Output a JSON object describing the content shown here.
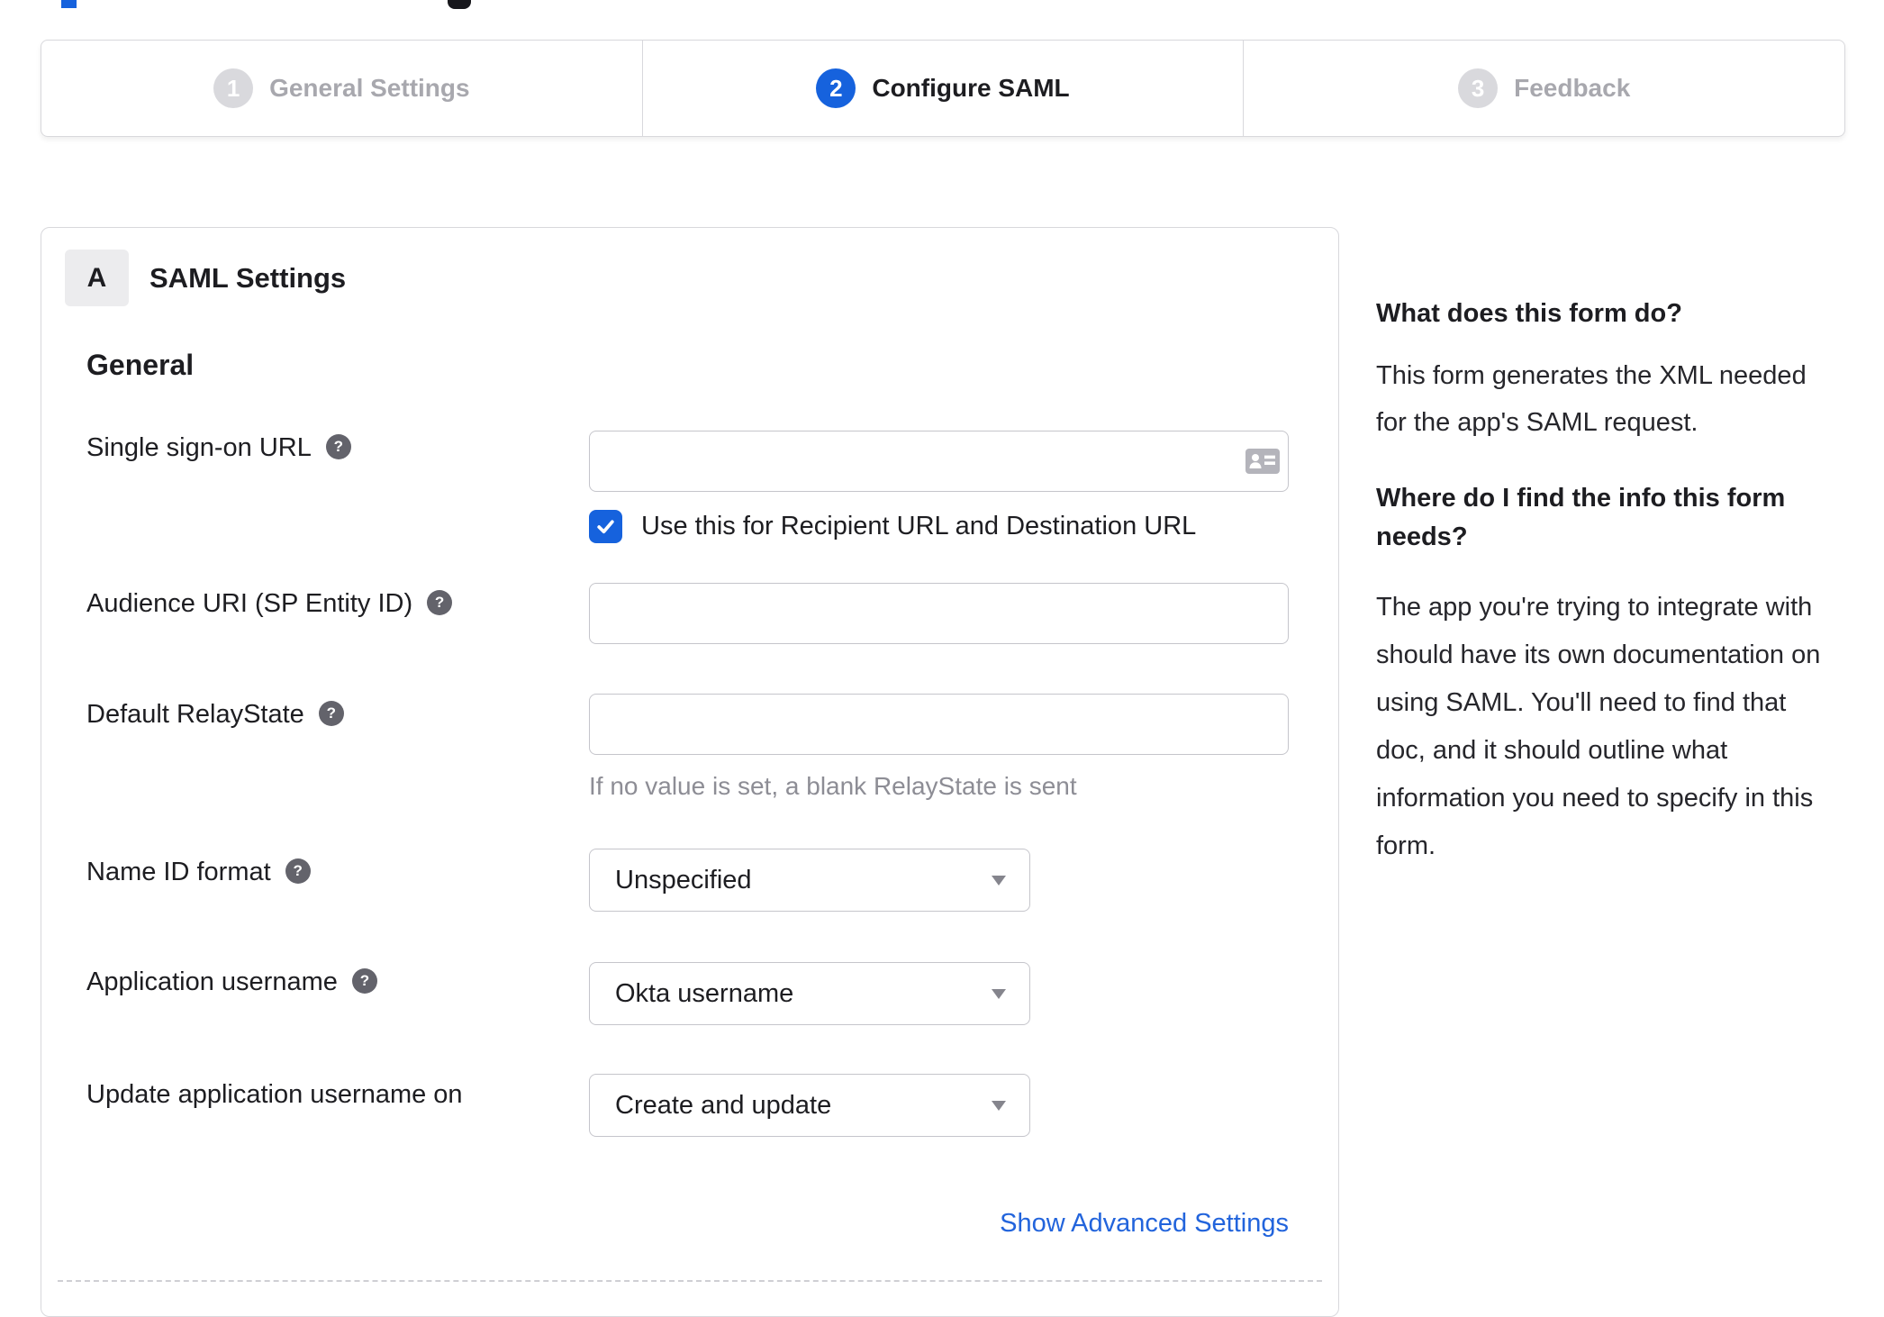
{
  "colors": {
    "accent_blue": "#1662dd",
    "link_blue": "#2264dc",
    "step_inactive_circle": "#d9d9dd",
    "step_inactive_label": "#a8a8ae",
    "border_gray": "#d8d8dc",
    "input_border": "#c5c5cb",
    "help_icon_bg": "#63636b",
    "helper_text": "#8d8d95",
    "text_dark": "#1d1d21",
    "badge_bg": "#ececee"
  },
  "icons": {
    "help_glyph": "?"
  },
  "stepper": {
    "steps": [
      {
        "number": "1",
        "label": "General Settings",
        "state": "inactive"
      },
      {
        "number": "2",
        "label": "Configure SAML",
        "state": "active"
      },
      {
        "number": "3",
        "label": "Feedback",
        "state": "inactive"
      }
    ]
  },
  "panel": {
    "badge": "A",
    "title": "SAML Settings",
    "group": "General",
    "fields": {
      "sso_url": {
        "label": "Single sign-on URL",
        "value": ""
      },
      "sso_checkbox": {
        "checked": true,
        "label": "Use this for Recipient URL and Destination URL"
      },
      "audience_uri": {
        "label": "Audience URI (SP Entity ID)",
        "value": ""
      },
      "relay_state": {
        "label": "Default RelayState",
        "value": "",
        "helper": "If no value is set, a blank RelayState is sent"
      },
      "name_id_format": {
        "label": "Name ID format",
        "value": "Unspecified"
      },
      "app_username": {
        "label": "Application username",
        "value": "Okta username"
      },
      "update_username": {
        "label": "Update application username on",
        "value": "Create and update"
      }
    },
    "advanced_link": "Show Advanced Settings"
  },
  "sidebar": {
    "sections": [
      {
        "heading_lines": [
          "What does this form do?"
        ],
        "body_lines": [
          "This form generates the XML needed",
          "for the app's SAML request."
        ]
      },
      {
        "heading_lines": [
          "Where do I find the info this form",
          "needs?"
        ],
        "body_lines": [
          "The app you're trying to integrate with",
          "should have its own documentation on",
          "using SAML. You'll need to find that",
          "doc, and it should outline what",
          "information you need to specify in this",
          "form."
        ]
      }
    ]
  }
}
